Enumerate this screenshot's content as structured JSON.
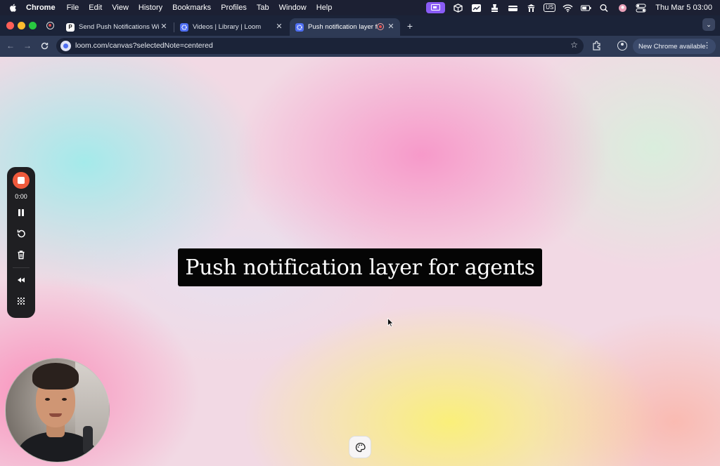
{
  "menubar": {
    "app_name": "Chrome",
    "menus": [
      "File",
      "Edit",
      "View",
      "History",
      "Bookmarks",
      "Profiles",
      "Tab",
      "Window",
      "Help"
    ],
    "input_source_badge": "US",
    "clock": "Thu Mar 5  03:00",
    "status_icons": [
      "screen-record-icon",
      "box-icon",
      "chart-icon",
      "stamp-icon",
      "wallet-icon",
      "figure-icon",
      "keyboard-badge-icon",
      "wifi-icon",
      "battery-icon",
      "spotlight-icon",
      "avatar-icon",
      "control-center-icon"
    ]
  },
  "tabs": [
    {
      "title": "Send Push Notifications With",
      "favicon": "P",
      "active": false
    },
    {
      "title": "Videos | Library | Loom",
      "favicon": "loom-icon",
      "active": false
    },
    {
      "title": "Push notification layer for",
      "favicon": "loom-icon",
      "active": true,
      "recording": true
    }
  ],
  "toolbar": {
    "url": "loom.com/canvas?selectedNote=centered",
    "update_label": "New Chrome available"
  },
  "canvas": {
    "note_title": "Push notification layer for agents"
  },
  "recorder": {
    "timer": "0:00",
    "controls": [
      "stop-icon",
      "pause-icon",
      "restart-icon",
      "trash-icon",
      "rewind-icon",
      "grid-icon"
    ]
  },
  "colors": {
    "menubar_bg": "#1c2033",
    "tabstrip_bg": "#1b2338",
    "toolbar_bg": "#2e3a55",
    "record_red": "#ef5a3c",
    "note_bg": "#050505"
  }
}
